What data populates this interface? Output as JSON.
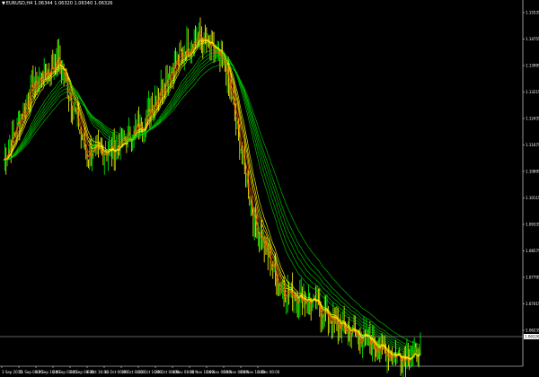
{
  "header": {
    "arrow": "▼",
    "text": "EURUSD,H4 1.06344 1.06320 1.06340 1.06326"
  },
  "colors": {
    "background": "#000000",
    "axis": "#ffffff",
    "bull_candle": "#00ff00",
    "bear_candle": "#ffff00",
    "ema_fast": "#ff6a00",
    "ema_mid": "#ffff00",
    "ema_slow": "#00c800",
    "current_price_line": "#c0c0c0"
  },
  "price_axis": {
    "labels": [
      "1.15535",
      "1.14755",
      "1.13995",
      "1.13215",
      "1.12435",
      "1.11675",
      "1.10895",
      "1.10115",
      "1.09335",
      "1.08575",
      "1.07795",
      "1.07015",
      "1.06235"
    ],
    "current_price": "1.06326"
  },
  "time_axis": {
    "labels": [
      "3 Sep 2015",
      "11 Sep 08:00",
      "17 Sep 16:00",
      "24 Sep 00:00",
      "30 Sep 08:00",
      "6 Oct 16:00",
      "13 Oct 00:00",
      "19 Oct 08:00",
      "23 Oct 16:00",
      "29 Oct 00:00",
      "4 Nov 08:00",
      "10 Nov 16:00",
      "16 Nov 00:00",
      "20 Nov 08:00",
      "26 Nov 16:00",
      "3 Dec 00:00"
    ]
  },
  "chart_data": {
    "type": "line",
    "symbol": "EURUSD",
    "timeframe": "H4",
    "ylim": [
      1.0585,
      1.1595
    ],
    "x": [
      "3 Sep 2015",
      "11 Sep 08:00",
      "17 Sep 16:00",
      "24 Sep 00:00",
      "30 Sep 08:00",
      "6 Oct 16:00",
      "13 Oct 00:00",
      "19 Oct 08:00",
      "23 Oct 16:00",
      "29 Oct 00:00",
      "4 Nov 08:00",
      "10 Nov 16:00",
      "16 Nov 00:00",
      "20 Nov 08:00",
      "26 Nov 16:00",
      "3 Dec 00:00"
    ],
    "series": [
      {
        "values": [
          1.1165,
          1.137,
          1.145,
          1.118,
          1.1195,
          1.127,
          1.142,
          1.152,
          1.142,
          1.1,
          1.08,
          1.077,
          1.07,
          1.066,
          1.0615,
          1.062
        ]
      }
    ]
  }
}
